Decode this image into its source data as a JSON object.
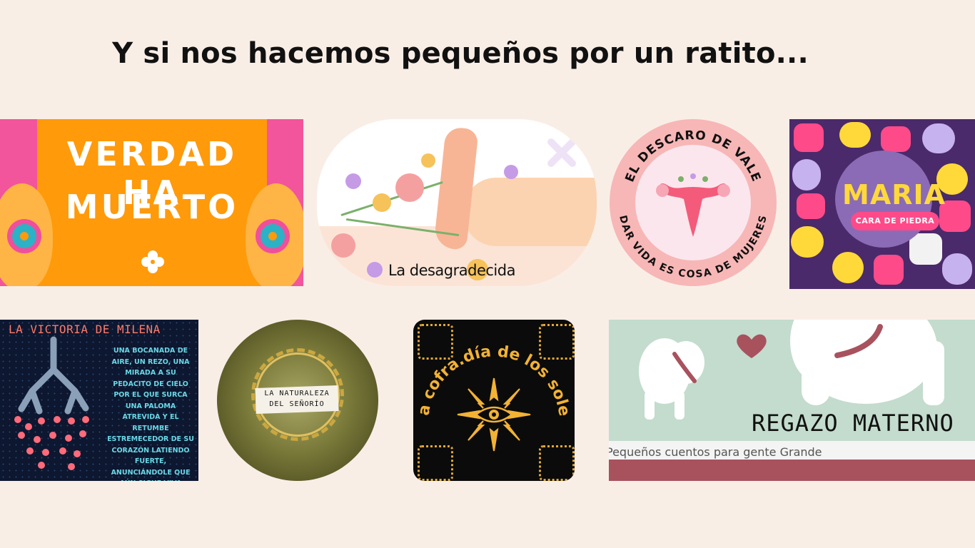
{
  "page": {
    "title": "Y si nos hacemos pequeños por un ratito..."
  },
  "cards": [
    {
      "id": "verdad",
      "line1": "VERDAD HA",
      "line2": "MUERTO"
    },
    {
      "id": "desagradecida",
      "label": "La desagradecida"
    },
    {
      "id": "descaro",
      "top_text": "EL DESCARO DE VALE",
      "bottom_text": "DAR VIDA ES COSA DE MUJERES"
    },
    {
      "id": "maria",
      "title": "MARIA",
      "subtitle": "CARA DE PIEDRA"
    },
    {
      "id": "victoria",
      "title": "LA VICTORIA DE MILENA",
      "body": "UNA BOCANADA DE AIRE, UN REZO, UNA MIRADA A SU PEDACITO DE CIELO POR EL QUE SURCA UNA PALOMA ATREVIDA Y EL RETUMBE ESTREMECEDOR DE SU CORAZÓN LATIENDO FUERTE, ANUNCIÁNDOLE QUE AÚN SIGUE VIVA"
    },
    {
      "id": "naturaleza",
      "line1": "LA NATURALEZA",
      "line2": "DEL SEÑORÍO"
    },
    {
      "id": "cofradia",
      "title": "La cofra.día de los soles"
    },
    {
      "id": "regazo",
      "title": "REGAZO MATERNO",
      "subtitle": "Pequeños cuentos para gente Grande"
    }
  ],
  "colors": {
    "background": "#f9eee6",
    "accent_pink": "#f2559b",
    "accent_orange": "#ff9a0b",
    "purple": "#4a2a6a",
    "gold": "#e0a83a",
    "sage": "#c3dccd",
    "rose": "#a8525e"
  }
}
